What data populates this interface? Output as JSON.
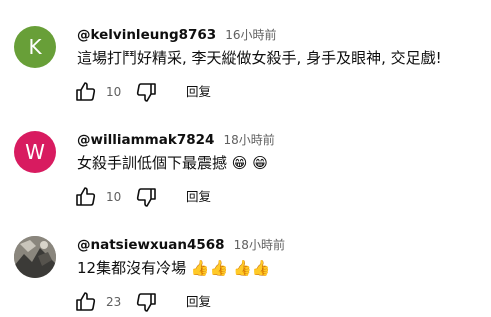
{
  "comments": [
    {
      "avatar_letter": "K",
      "avatar_color": "#689f38",
      "handle": "@kelvinleung8763",
      "time": "16小時前",
      "text": "這場打鬥好精采, 李天縱做女殺手, 身手及眼神, 交足戲!",
      "emojis": "",
      "likes": "10",
      "reply_label": "回复"
    },
    {
      "avatar_letter": "W",
      "avatar_color": "#d81b60",
      "handle": "@williammak7824",
      "time": "18小時前",
      "text": "女殺手訓低個下最震撼",
      "emojis": "😁 😁",
      "likes": "10",
      "reply_label": "回复"
    },
    {
      "avatar_letter": "",
      "avatar_color": "#6d6a63",
      "handle": "@natsiewxuan4568",
      "time": "18小時前",
      "text": "12集都沒有冷場",
      "emojis": "👍👍 👍👍",
      "likes": "23",
      "reply_label": "回复"
    }
  ],
  "icons": {
    "like": "thumb-up-outline-icon",
    "dislike": "thumb-down-outline-icon"
  }
}
